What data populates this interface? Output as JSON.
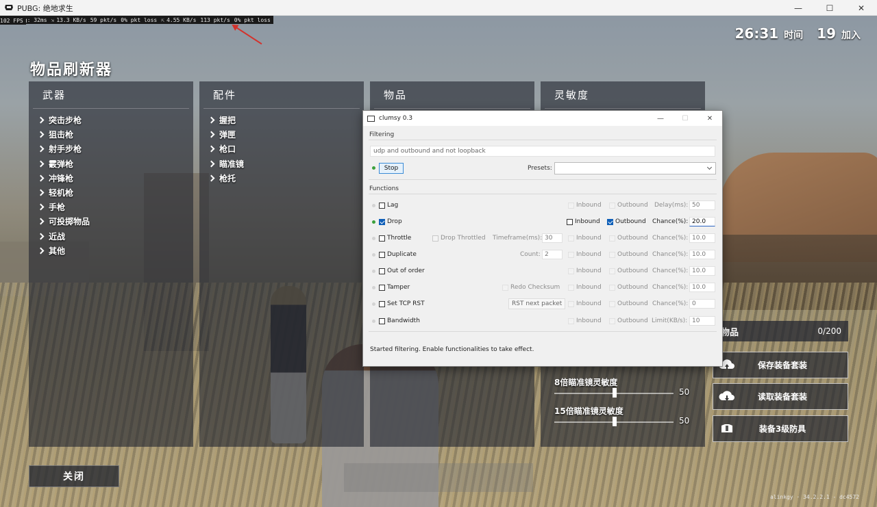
{
  "window": {
    "title": "PUBG: 绝地求生",
    "minimize": "—",
    "maximize": "☐",
    "close": "✕"
  },
  "stats": {
    "fps": "102 FPS",
    "ping": "ng: 32ms",
    "down_rate": "13.3 KB/s",
    "down_pkt": "59 pkt/s",
    "down_loss": "0% pkt loss",
    "up_rate": "4.55 KB/s",
    "up_pkt": "113 pkt/s",
    "up_loss": "0% pkt loss"
  },
  "timer": {
    "time": "26:31",
    "time_label": "时间",
    "joined": "19",
    "joined_label": "加入"
  },
  "spawner": {
    "title": "物品刷新器",
    "panels": [
      {
        "title": "武器",
        "items": [
          "突击步枪",
          "狙击枪",
          "射手步枪",
          "霰弹枪",
          "冲锋枪",
          "轻机枪",
          "手枪",
          "可投掷物品",
          "近战",
          "其他"
        ]
      },
      {
        "title": "配件",
        "items": [
          "握把",
          "弹匣",
          "枪口",
          "瞄准镜",
          "枪托"
        ]
      },
      {
        "title": "物品",
        "items": []
      },
      {
        "title": "灵敏度",
        "items": []
      }
    ],
    "close_label": "关闭"
  },
  "sensitivity": [
    {
      "label": "8倍瞄准镜灵敏度",
      "value": "50"
    },
    {
      "label": "15倍瞄准镜灵敏度",
      "value": "50"
    }
  ],
  "items_panel": {
    "title": "物品",
    "count": "0/200"
  },
  "side_buttons": [
    "保存装备套装",
    "读取装备套装",
    "装备3级防具"
  ],
  "version": "alinkgy · 34.2.2.1 - dc4572",
  "clumsy": {
    "title": "clumsy 0.3",
    "filtering_label": "Filtering",
    "filter_value": "udp and outbound and not loopback",
    "stop_label": "Stop",
    "presets_label": "Presets:",
    "functions_label": "Functions",
    "rows": {
      "lag": {
        "name": "Lag",
        "inbound": "Inbound",
        "outbound": "Outbound",
        "param": "Delay(ms):",
        "value": "50"
      },
      "drop": {
        "name": "Drop",
        "inbound": "Inbound",
        "outbound": "Outbound",
        "param": "Chance(%):",
        "value": "20.0"
      },
      "throttle": {
        "name": "Throttle",
        "extra": "Drop Throttled",
        "tf_label": "Timeframe(ms):",
        "tf_value": "30",
        "inbound": "Inbound",
        "outbound": "Outbound",
        "param": "Chance(%):",
        "value": "10.0"
      },
      "duplicate": {
        "name": "Duplicate",
        "count_label": "Count:",
        "count_value": "2",
        "inbound": "Inbound",
        "outbound": "Outbound",
        "param": "Chance(%):",
        "value": "10.0"
      },
      "ooo": {
        "name": "Out of order",
        "inbound": "Inbound",
        "outbound": "Outbound",
        "param": "Chance(%):",
        "value": "10.0"
      },
      "tamper": {
        "name": "Tamper",
        "extra": "Redo Checksum",
        "inbound": "Inbound",
        "outbound": "Outbound",
        "param": "Chance(%):",
        "value": "10.0"
      },
      "rst": {
        "name": "Set TCP RST",
        "extra": "RST next packet",
        "inbound": "Inbound",
        "outbound": "Outbound",
        "param": "Chance(%):",
        "value": "0"
      },
      "bandwidth": {
        "name": "Bandwidth",
        "inbound": "Inbound",
        "outbound": "Outbound",
        "param": "Limit(KB/s):",
        "value": "10"
      }
    },
    "status": "Started filtering. Enable functionalities to take effect."
  },
  "colors": {
    "fps": "#3cf03c",
    "arrow": "#d4322c",
    "active_dot": "#3ca03c",
    "checkbox": "#0f5fb8"
  }
}
